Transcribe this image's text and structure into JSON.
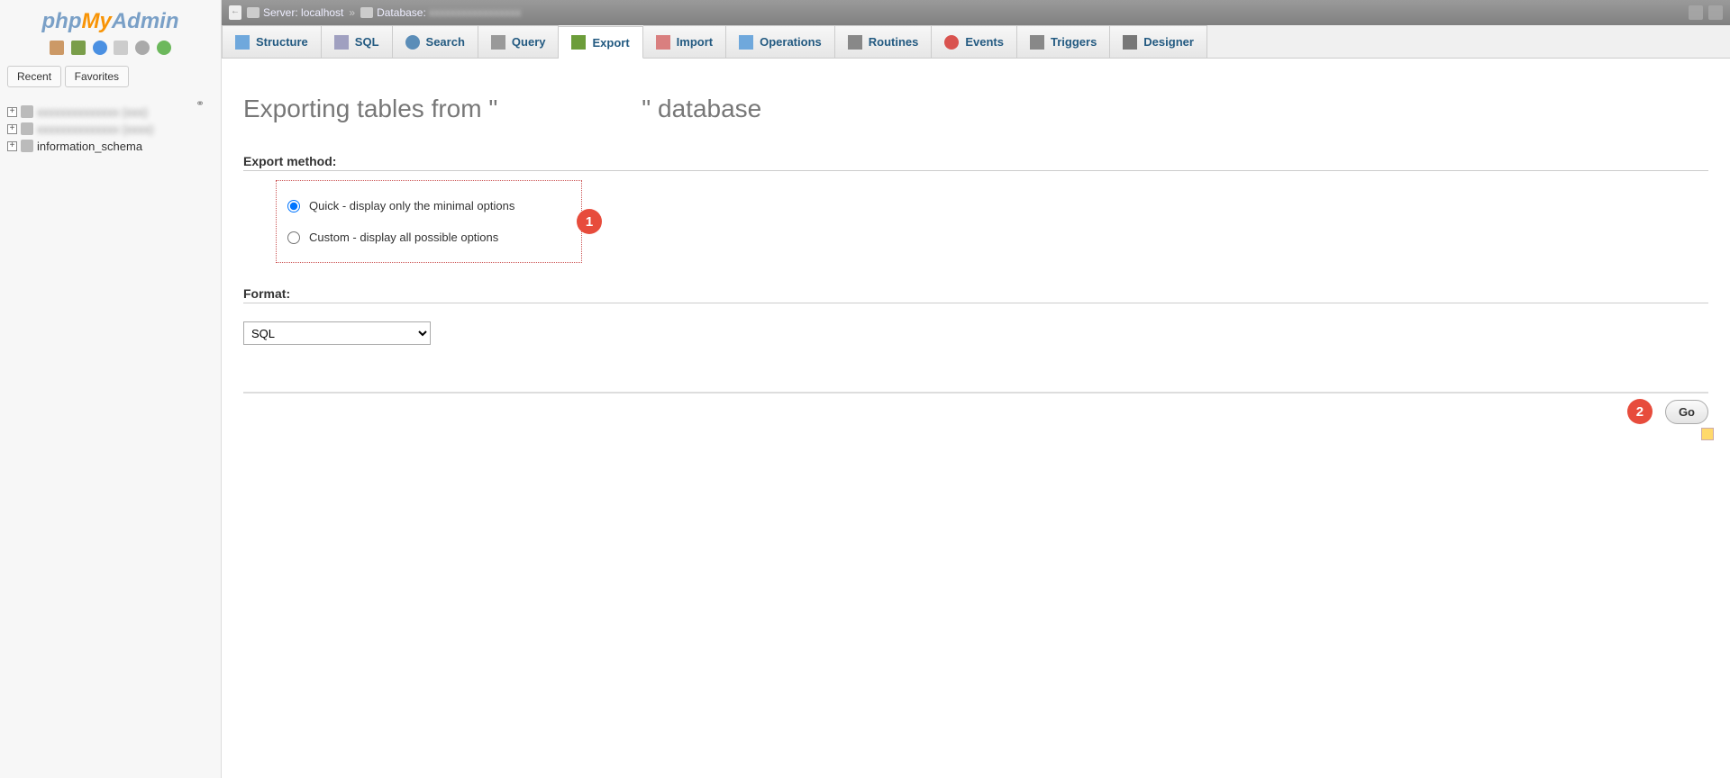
{
  "logo": {
    "p1": "php",
    "p2": "My",
    "p3": "Admin"
  },
  "sidebar": {
    "tabs": {
      "recent": "Recent",
      "favorites": "Favorites"
    },
    "items": [
      {
        "label": "",
        "blurred": true
      },
      {
        "label": "",
        "blurred": true
      },
      {
        "label": "information_schema",
        "blurred": false
      }
    ]
  },
  "breadcrumb": {
    "server_label": "Server:",
    "server_value": "localhost",
    "sep": "»",
    "database_label": "Database:",
    "database_value": ""
  },
  "navtabs": [
    {
      "label": "Structure",
      "icon": "ti-struct",
      "active": false
    },
    {
      "label": "SQL",
      "icon": "ti-sql",
      "active": false
    },
    {
      "label": "Search",
      "icon": "ti-search",
      "active": false
    },
    {
      "label": "Query",
      "icon": "ti-query",
      "active": false
    },
    {
      "label": "Export",
      "icon": "ti-export",
      "active": true
    },
    {
      "label": "Import",
      "icon": "ti-import",
      "active": false
    },
    {
      "label": "Operations",
      "icon": "ti-ops",
      "active": false
    },
    {
      "label": "Routines",
      "icon": "ti-rout",
      "active": false
    },
    {
      "label": "Events",
      "icon": "ti-events",
      "active": false
    },
    {
      "label": "Triggers",
      "icon": "ti-trig",
      "active": false
    },
    {
      "label": "Designer",
      "icon": "ti-design",
      "active": false
    }
  ],
  "page": {
    "title_prefix": "Exporting tables from \"",
    "title_dbname": "",
    "title_suffix": "\" database",
    "export_method_label": "Export method:",
    "radio_quick": "Quick - display only the minimal options",
    "radio_custom": "Custom - display all possible options",
    "format_label": "Format:",
    "format_selected": "SQL",
    "go_button": "Go",
    "annotations": {
      "badge1": "1",
      "badge2": "2"
    }
  }
}
